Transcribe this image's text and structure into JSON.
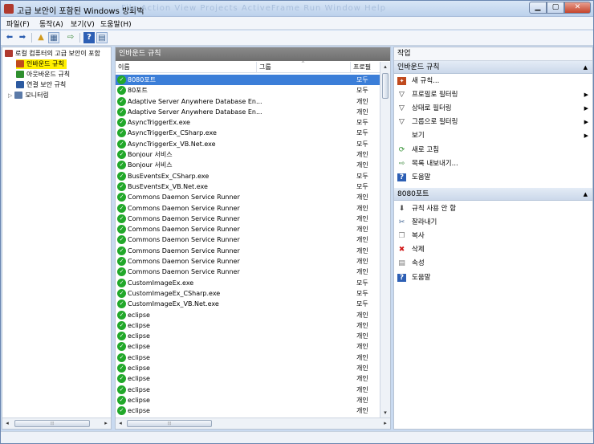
{
  "window": {
    "title": "고급 보안이 포함된 Windows 방화벽",
    "ghost_menu": "File   Action   View   Projects   ActiveFrame   Run   Window   Help"
  },
  "menu": [
    "파일(F)",
    "동작(A)",
    "보기(V)",
    "도움말(H)"
  ],
  "toolbar": {
    "icons": [
      "back-icon",
      "forward-icon",
      "up-folder-icon",
      "show-hide-pane-icon",
      "export-icon",
      "help-icon",
      "console-icon"
    ]
  },
  "tree": {
    "root": "로컬 컴퓨터의 고급 보안이 포함",
    "items": [
      "인바운드 규칙",
      "아웃바운드 규칙",
      "연결 보안 규칙",
      "모니터링"
    ],
    "colors": {
      "inbound": "#c04a1e",
      "outbound": "#2f8f2f",
      "connection": "#2c5aa0",
      "monitor": "#5b7aa8"
    }
  },
  "main": {
    "header": "인바운드 규칙",
    "columns": {
      "name": "이름",
      "group": "그룹",
      "profile": "프로필"
    },
    "rows": [
      {
        "name": "8080포트",
        "profile": "모두",
        "selected": true
      },
      {
        "name": "80포트",
        "profile": "모두"
      },
      {
        "name": "Adaptive Server Anywhere Database En...",
        "profile": "개인"
      },
      {
        "name": "Adaptive Server Anywhere Database En...",
        "profile": "개인"
      },
      {
        "name": "AsyncTriggerEx.exe",
        "profile": "모두"
      },
      {
        "name": "AsyncTriggerEx_CSharp.exe",
        "profile": "모두"
      },
      {
        "name": "AsyncTriggerEx_VB.Net.exe",
        "profile": "모두"
      },
      {
        "name": "Bonjour 서비스",
        "profile": "개인"
      },
      {
        "name": "Bonjour 서비스",
        "profile": "개인"
      },
      {
        "name": "BusEventsEx_CSharp.exe",
        "profile": "모두"
      },
      {
        "name": "BusEventsEx_VB.Net.exe",
        "profile": "모두"
      },
      {
        "name": "Commons Daemon Service Runner",
        "profile": "개인"
      },
      {
        "name": "Commons Daemon Service Runner",
        "profile": "개인"
      },
      {
        "name": "Commons Daemon Service Runner",
        "profile": "개인"
      },
      {
        "name": "Commons Daemon Service Runner",
        "profile": "개인"
      },
      {
        "name": "Commons Daemon Service Runner",
        "profile": "개인"
      },
      {
        "name": "Commons Daemon Service Runner",
        "profile": "개인"
      },
      {
        "name": "Commons Daemon Service Runner",
        "profile": "개인"
      },
      {
        "name": "Commons Daemon Service Runner",
        "profile": "개인"
      },
      {
        "name": "CustomImageEx.exe",
        "profile": "모두"
      },
      {
        "name": "CustomImageEx_CSharp.exe",
        "profile": "모두"
      },
      {
        "name": "CustomImageEx_VB.Net.exe",
        "profile": "모두"
      },
      {
        "name": "eclipse",
        "profile": "개인"
      },
      {
        "name": "eclipse",
        "profile": "개인"
      },
      {
        "name": "eclipse",
        "profile": "개인"
      },
      {
        "name": "eclipse",
        "profile": "개인"
      },
      {
        "name": "eclipse",
        "profile": "개인"
      },
      {
        "name": "eclipse",
        "profile": "개인"
      },
      {
        "name": "eclipse",
        "profile": "개인"
      },
      {
        "name": "eclipse",
        "profile": "개인"
      },
      {
        "name": "eclipse",
        "profile": "개인"
      },
      {
        "name": "eclipse",
        "profile": "개인"
      }
    ],
    "enabled_color": "#22a82a",
    "selection_color": "#3b7ed8"
  },
  "actions": {
    "title": "작업",
    "section1": {
      "header": "인바운드 규칙",
      "items": [
        {
          "label": "새 규칙...",
          "icon": "new-rule-icon",
          "submenu": false
        },
        {
          "label": "프로필로 필터링",
          "icon": "filter-icon",
          "submenu": true
        },
        {
          "label": "상태로 필터링",
          "icon": "filter-icon",
          "submenu": true
        },
        {
          "label": "그룹으로 필터링",
          "icon": "filter-icon",
          "submenu": true
        },
        {
          "label": "보기",
          "icon": "",
          "submenu": true
        },
        {
          "label": "새로 고침",
          "icon": "refresh-icon",
          "submenu": false
        },
        {
          "label": "목록 내보내기...",
          "icon": "export-list-icon",
          "submenu": false
        },
        {
          "label": "도움말",
          "icon": "help-icon",
          "submenu": false
        }
      ]
    },
    "section2": {
      "header": "8080포트",
      "items": [
        {
          "label": "규칙 사용 안 함",
          "icon": "disable-rule-icon"
        },
        {
          "label": "잘라내기",
          "icon": "cut-icon"
        },
        {
          "label": "복사",
          "icon": "copy-icon"
        },
        {
          "label": "삭제",
          "icon": "delete-icon"
        },
        {
          "label": "속성",
          "icon": "properties-icon"
        },
        {
          "label": "도움말",
          "icon": "help-icon"
        }
      ]
    }
  }
}
